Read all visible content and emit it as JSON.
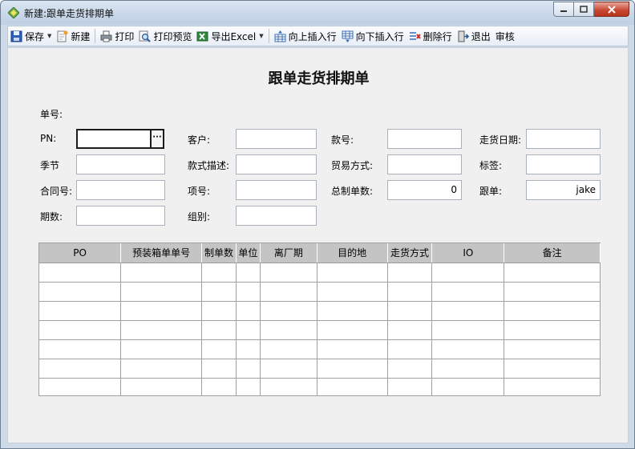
{
  "window": {
    "title": "新建:跟单走货排期单"
  },
  "toolbar": {
    "save": "保存",
    "new": "新建",
    "print": "打印",
    "print_preview": "打印预览",
    "export_excel": "导出Excel",
    "insert_above": "向上插入行",
    "insert_below": "向下插入行",
    "delete_row": "删除行",
    "exit": "退出",
    "review": "审核"
  },
  "form": {
    "title": "跟单走货排期单",
    "order_no_label": "单号:",
    "pn_label": "PN:",
    "pn_value": "",
    "customer_label": "客户:",
    "customer_value": "",
    "style_no_label": "款号:",
    "style_no_value": "",
    "ship_date_label": "走货日期:",
    "ship_date_value": "",
    "season_label": "季节",
    "season_value": "",
    "style_desc_label": "款式描述:",
    "style_desc_value": "",
    "trade_label": "贸易方式:",
    "trade_value": "",
    "tag_label": "标签:",
    "tag_value": "",
    "contract_label": "合同号:",
    "contract_value": "",
    "item_label": "项号:",
    "item_value": "",
    "total_label": "总制单数:",
    "total_value": "0",
    "follower_label": "跟单:",
    "follower_value": "jake",
    "period_label": "期数:",
    "period_value": "",
    "group_label": "组别:",
    "group_value": ""
  },
  "grid": {
    "columns": [
      "PO",
      "预装箱单单号",
      "制单数",
      "单位",
      "离厂期",
      "目的地",
      "走货方式",
      "IO",
      "备注"
    ],
    "empty_rows": 7
  }
}
